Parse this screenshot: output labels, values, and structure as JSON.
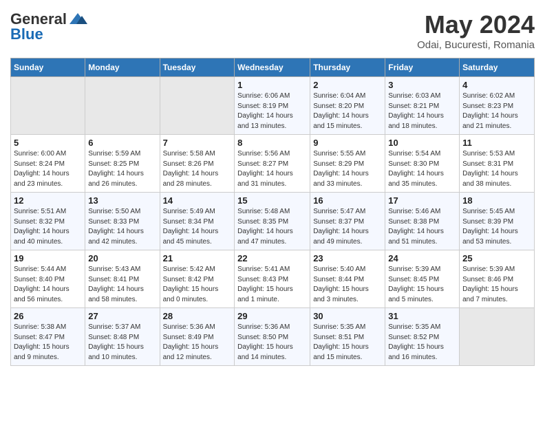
{
  "header": {
    "logo_general": "General",
    "logo_blue": "Blue",
    "month_year": "May 2024",
    "location": "Odai, Bucuresti, Romania"
  },
  "weekdays": [
    "Sunday",
    "Monday",
    "Tuesday",
    "Wednesday",
    "Thursday",
    "Friday",
    "Saturday"
  ],
  "weeks": [
    [
      {
        "day": "",
        "info": ""
      },
      {
        "day": "",
        "info": ""
      },
      {
        "day": "",
        "info": ""
      },
      {
        "day": "1",
        "info": "Sunrise: 6:06 AM\nSunset: 8:19 PM\nDaylight: 14 hours\nand 13 minutes."
      },
      {
        "day": "2",
        "info": "Sunrise: 6:04 AM\nSunset: 8:20 PM\nDaylight: 14 hours\nand 15 minutes."
      },
      {
        "day": "3",
        "info": "Sunrise: 6:03 AM\nSunset: 8:21 PM\nDaylight: 14 hours\nand 18 minutes."
      },
      {
        "day": "4",
        "info": "Sunrise: 6:02 AM\nSunset: 8:23 PM\nDaylight: 14 hours\nand 21 minutes."
      }
    ],
    [
      {
        "day": "5",
        "info": "Sunrise: 6:00 AM\nSunset: 8:24 PM\nDaylight: 14 hours\nand 23 minutes."
      },
      {
        "day": "6",
        "info": "Sunrise: 5:59 AM\nSunset: 8:25 PM\nDaylight: 14 hours\nand 26 minutes."
      },
      {
        "day": "7",
        "info": "Sunrise: 5:58 AM\nSunset: 8:26 PM\nDaylight: 14 hours\nand 28 minutes."
      },
      {
        "day": "8",
        "info": "Sunrise: 5:56 AM\nSunset: 8:27 PM\nDaylight: 14 hours\nand 31 minutes."
      },
      {
        "day": "9",
        "info": "Sunrise: 5:55 AM\nSunset: 8:29 PM\nDaylight: 14 hours\nand 33 minutes."
      },
      {
        "day": "10",
        "info": "Sunrise: 5:54 AM\nSunset: 8:30 PM\nDaylight: 14 hours\nand 35 minutes."
      },
      {
        "day": "11",
        "info": "Sunrise: 5:53 AM\nSunset: 8:31 PM\nDaylight: 14 hours\nand 38 minutes."
      }
    ],
    [
      {
        "day": "12",
        "info": "Sunrise: 5:51 AM\nSunset: 8:32 PM\nDaylight: 14 hours\nand 40 minutes."
      },
      {
        "day": "13",
        "info": "Sunrise: 5:50 AM\nSunset: 8:33 PM\nDaylight: 14 hours\nand 42 minutes."
      },
      {
        "day": "14",
        "info": "Sunrise: 5:49 AM\nSunset: 8:34 PM\nDaylight: 14 hours\nand 45 minutes."
      },
      {
        "day": "15",
        "info": "Sunrise: 5:48 AM\nSunset: 8:35 PM\nDaylight: 14 hours\nand 47 minutes."
      },
      {
        "day": "16",
        "info": "Sunrise: 5:47 AM\nSunset: 8:37 PM\nDaylight: 14 hours\nand 49 minutes."
      },
      {
        "day": "17",
        "info": "Sunrise: 5:46 AM\nSunset: 8:38 PM\nDaylight: 14 hours\nand 51 minutes."
      },
      {
        "day": "18",
        "info": "Sunrise: 5:45 AM\nSunset: 8:39 PM\nDaylight: 14 hours\nand 53 minutes."
      }
    ],
    [
      {
        "day": "19",
        "info": "Sunrise: 5:44 AM\nSunset: 8:40 PM\nDaylight: 14 hours\nand 56 minutes."
      },
      {
        "day": "20",
        "info": "Sunrise: 5:43 AM\nSunset: 8:41 PM\nDaylight: 14 hours\nand 58 minutes."
      },
      {
        "day": "21",
        "info": "Sunrise: 5:42 AM\nSunset: 8:42 PM\nDaylight: 15 hours\nand 0 minutes."
      },
      {
        "day": "22",
        "info": "Sunrise: 5:41 AM\nSunset: 8:43 PM\nDaylight: 15 hours\nand 1 minute."
      },
      {
        "day": "23",
        "info": "Sunrise: 5:40 AM\nSunset: 8:44 PM\nDaylight: 15 hours\nand 3 minutes."
      },
      {
        "day": "24",
        "info": "Sunrise: 5:39 AM\nSunset: 8:45 PM\nDaylight: 15 hours\nand 5 minutes."
      },
      {
        "day": "25",
        "info": "Sunrise: 5:39 AM\nSunset: 8:46 PM\nDaylight: 15 hours\nand 7 minutes."
      }
    ],
    [
      {
        "day": "26",
        "info": "Sunrise: 5:38 AM\nSunset: 8:47 PM\nDaylight: 15 hours\nand 9 minutes."
      },
      {
        "day": "27",
        "info": "Sunrise: 5:37 AM\nSunset: 8:48 PM\nDaylight: 15 hours\nand 10 minutes."
      },
      {
        "day": "28",
        "info": "Sunrise: 5:36 AM\nSunset: 8:49 PM\nDaylight: 15 hours\nand 12 minutes."
      },
      {
        "day": "29",
        "info": "Sunrise: 5:36 AM\nSunset: 8:50 PM\nDaylight: 15 hours\nand 14 minutes."
      },
      {
        "day": "30",
        "info": "Sunrise: 5:35 AM\nSunset: 8:51 PM\nDaylight: 15 hours\nand 15 minutes."
      },
      {
        "day": "31",
        "info": "Sunrise: 5:35 AM\nSunset: 8:52 PM\nDaylight: 15 hours\nand 16 minutes."
      },
      {
        "day": "",
        "info": ""
      }
    ]
  ]
}
